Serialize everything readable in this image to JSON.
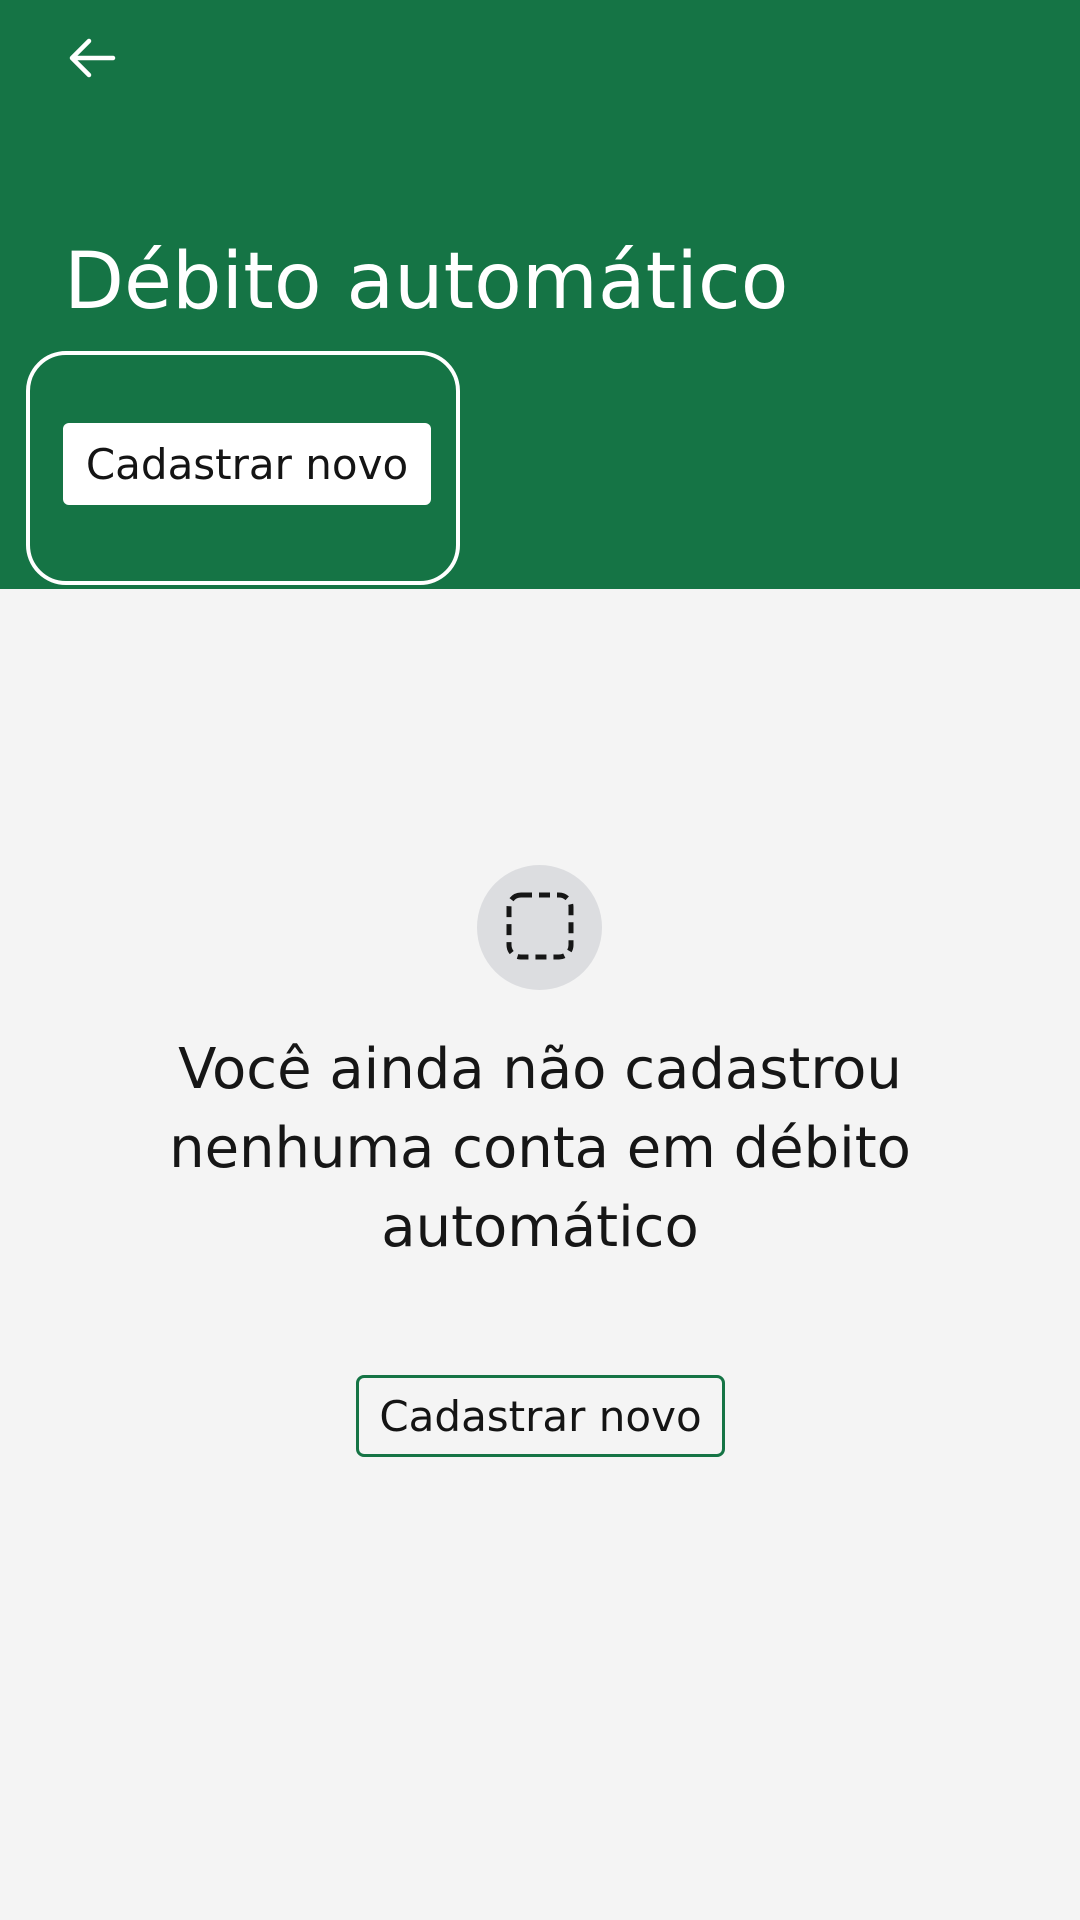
{
  "header": {
    "background_color": "#157445",
    "back_icon": "arrow-left-icon",
    "title": "Débito automático",
    "primary_button_label": "Cadastrar novo"
  },
  "empty_state": {
    "icon": "dashed-square-icon",
    "message": "Você ainda não cadastrou nenhuma conta em débito automático",
    "button_label": "Cadastrar novo"
  },
  "colors": {
    "accent": "#157445",
    "background": "#f4f4f4",
    "icon_circle": "#dcdde0"
  }
}
